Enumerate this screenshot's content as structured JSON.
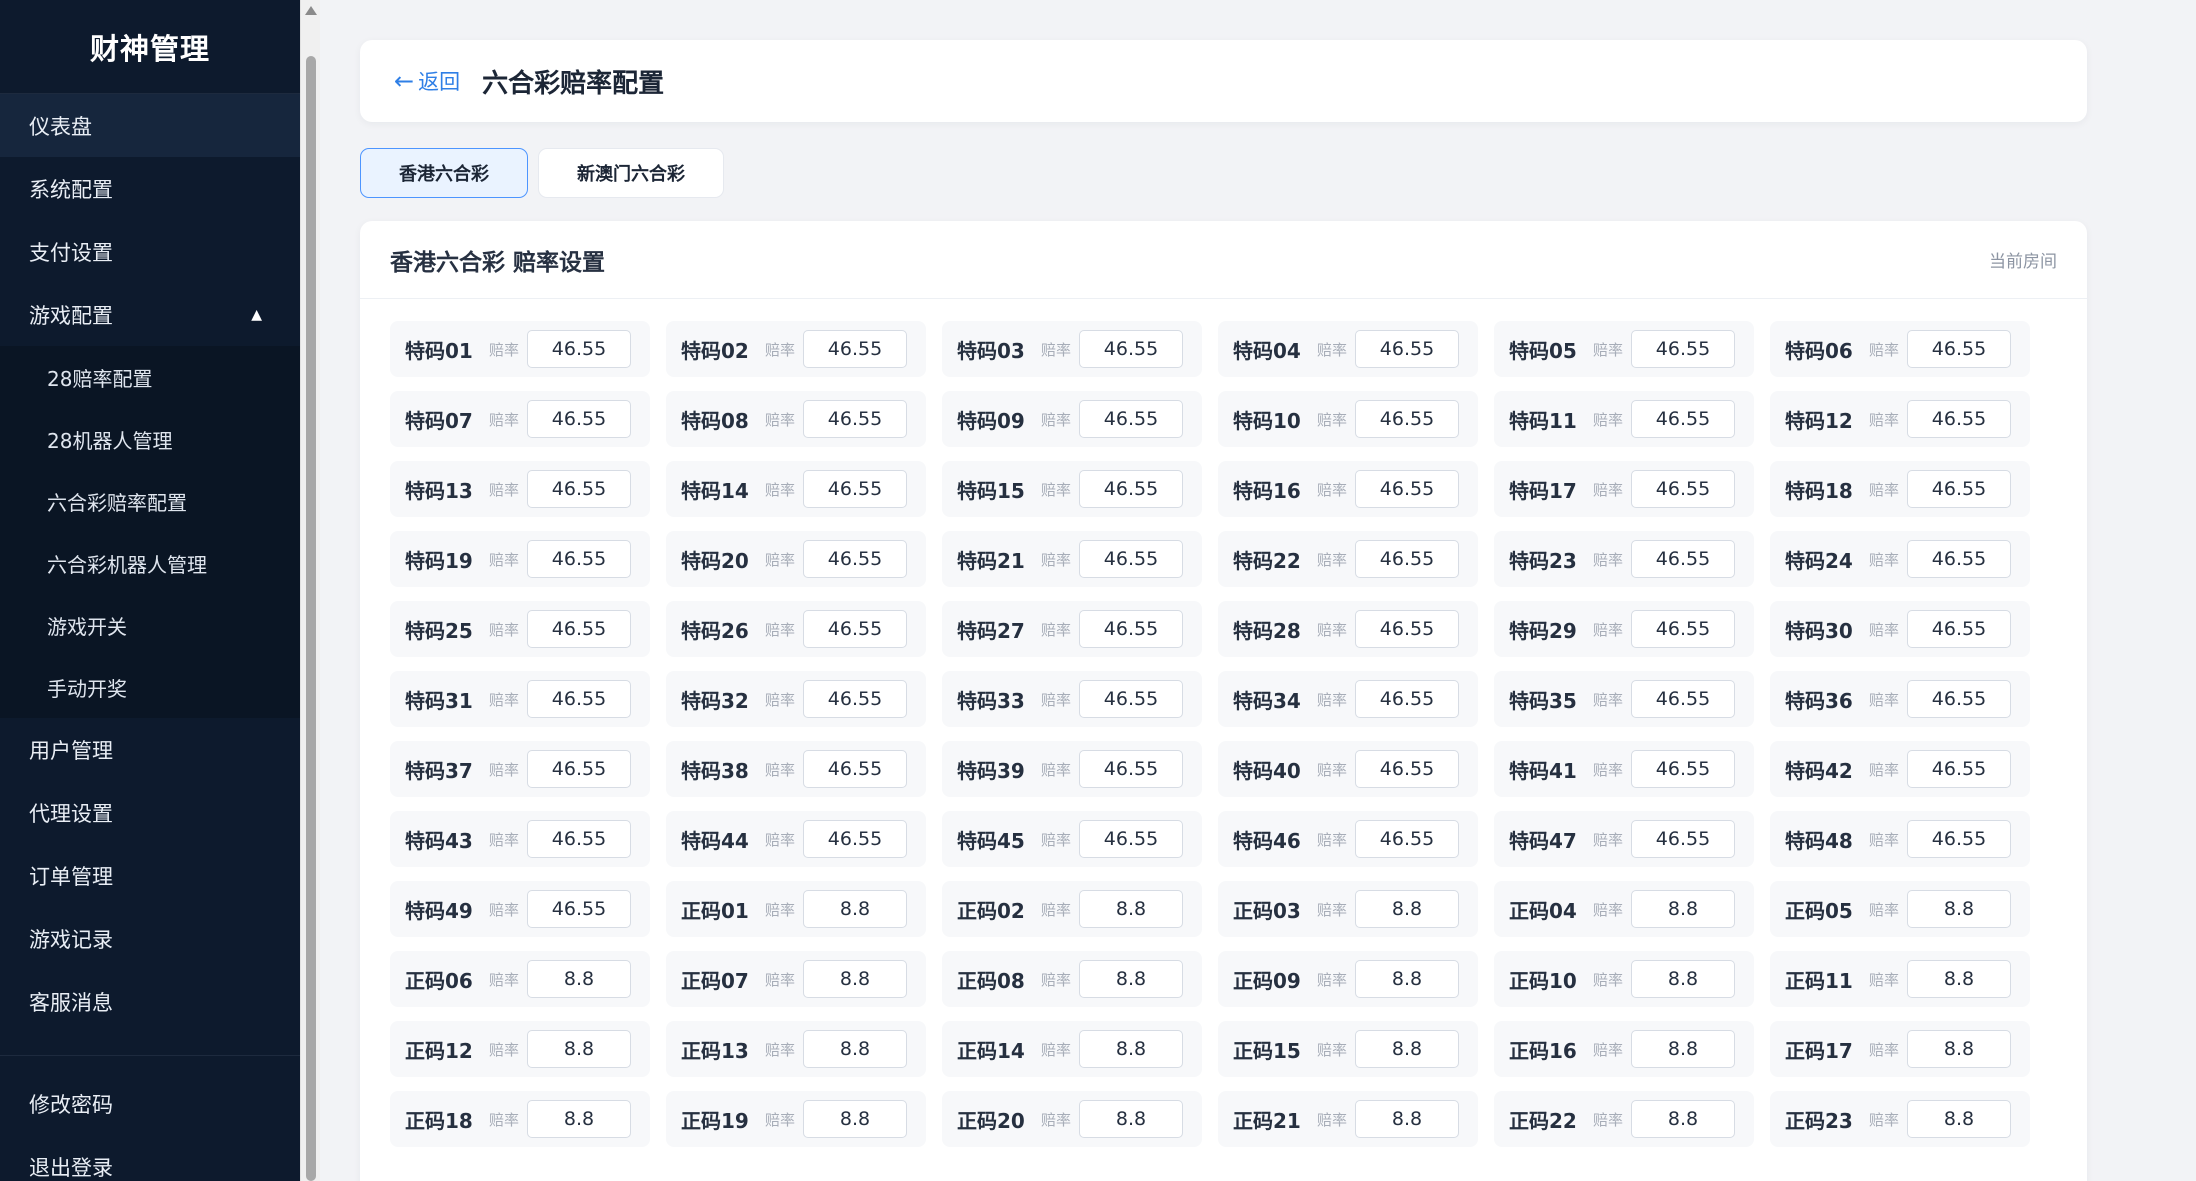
{
  "sidebar": {
    "brand": "财神管理",
    "items": [
      {
        "label": "仪表盘"
      },
      {
        "label": "系统配置"
      },
      {
        "label": "支付设置"
      },
      {
        "label": "游戏配置",
        "caret": "▲"
      },
      {
        "label": "用户管理"
      },
      {
        "label": "代理设置"
      },
      {
        "label": "订单管理"
      },
      {
        "label": "游戏记录"
      },
      {
        "label": "客服消息"
      }
    ],
    "sub_items": [
      {
        "label": "28赔率配置"
      },
      {
        "label": "28机器人管理"
      },
      {
        "label": "六合彩赔率配置"
      },
      {
        "label": "六合彩机器人管理"
      },
      {
        "label": "游戏开关"
      },
      {
        "label": "手动开奖"
      }
    ],
    "bottom_items": [
      {
        "label": "修改密码"
      },
      {
        "label": "退出登录"
      }
    ]
  },
  "header": {
    "back_label": "返回",
    "back_arrow": "←",
    "title": "六合彩赔率配置"
  },
  "tabs": [
    {
      "label": "香港六合彩",
      "active": true
    },
    {
      "label": "新澳门六合彩",
      "active": false
    }
  ],
  "odds_panel": {
    "title": "香港六合彩 赔率设置",
    "room_label": "当前房间",
    "odds_label": "赔率",
    "cells": [
      {
        "code": "特码01",
        "value": "46.55"
      },
      {
        "code": "特码02",
        "value": "46.55"
      },
      {
        "code": "特码03",
        "value": "46.55"
      },
      {
        "code": "特码04",
        "value": "46.55"
      },
      {
        "code": "特码05",
        "value": "46.55"
      },
      {
        "code": "特码06",
        "value": "46.55"
      },
      {
        "code": "特码07",
        "value": "46.55"
      },
      {
        "code": "特码08",
        "value": "46.55"
      },
      {
        "code": "特码09",
        "value": "46.55"
      },
      {
        "code": "特码10",
        "value": "46.55"
      },
      {
        "code": "特码11",
        "value": "46.55"
      },
      {
        "code": "特码12",
        "value": "46.55"
      },
      {
        "code": "特码13",
        "value": "46.55"
      },
      {
        "code": "特码14",
        "value": "46.55"
      },
      {
        "code": "特码15",
        "value": "46.55"
      },
      {
        "code": "特码16",
        "value": "46.55"
      },
      {
        "code": "特码17",
        "value": "46.55"
      },
      {
        "code": "特码18",
        "value": "46.55"
      },
      {
        "code": "特码19",
        "value": "46.55"
      },
      {
        "code": "特码20",
        "value": "46.55"
      },
      {
        "code": "特码21",
        "value": "46.55"
      },
      {
        "code": "特码22",
        "value": "46.55"
      },
      {
        "code": "特码23",
        "value": "46.55"
      },
      {
        "code": "特码24",
        "value": "46.55"
      },
      {
        "code": "特码25",
        "value": "46.55"
      },
      {
        "code": "特码26",
        "value": "46.55"
      },
      {
        "code": "特码27",
        "value": "46.55"
      },
      {
        "code": "特码28",
        "value": "46.55"
      },
      {
        "code": "特码29",
        "value": "46.55"
      },
      {
        "code": "特码30",
        "value": "46.55"
      },
      {
        "code": "特码31",
        "value": "46.55"
      },
      {
        "code": "特码32",
        "value": "46.55"
      },
      {
        "code": "特码33",
        "value": "46.55"
      },
      {
        "code": "特码34",
        "value": "46.55"
      },
      {
        "code": "特码35",
        "value": "46.55"
      },
      {
        "code": "特码36",
        "value": "46.55"
      },
      {
        "code": "特码37",
        "value": "46.55"
      },
      {
        "code": "特码38",
        "value": "46.55"
      },
      {
        "code": "特码39",
        "value": "46.55"
      },
      {
        "code": "特码40",
        "value": "46.55"
      },
      {
        "code": "特码41",
        "value": "46.55"
      },
      {
        "code": "特码42",
        "value": "46.55"
      },
      {
        "code": "特码43",
        "value": "46.55"
      },
      {
        "code": "特码44",
        "value": "46.55"
      },
      {
        "code": "特码45",
        "value": "46.55"
      },
      {
        "code": "特码46",
        "value": "46.55"
      },
      {
        "code": "特码47",
        "value": "46.55"
      },
      {
        "code": "特码48",
        "value": "46.55"
      },
      {
        "code": "特码49",
        "value": "46.55"
      },
      {
        "code": "正码01",
        "value": "8.8"
      },
      {
        "code": "正码02",
        "value": "8.8"
      },
      {
        "code": "正码03",
        "value": "8.8"
      },
      {
        "code": "正码04",
        "value": "8.8"
      },
      {
        "code": "正码05",
        "value": "8.8"
      },
      {
        "code": "正码06",
        "value": "8.8"
      },
      {
        "code": "正码07",
        "value": "8.8"
      },
      {
        "code": "正码08",
        "value": "8.8"
      },
      {
        "code": "正码09",
        "value": "8.8"
      },
      {
        "code": "正码10",
        "value": "8.8"
      },
      {
        "code": "正码11",
        "value": "8.8"
      },
      {
        "code": "正码12",
        "value": "8.8"
      },
      {
        "code": "正码13",
        "value": "8.8"
      },
      {
        "code": "正码14",
        "value": "8.8"
      },
      {
        "code": "正码15",
        "value": "8.8"
      },
      {
        "code": "正码16",
        "value": "8.8"
      },
      {
        "code": "正码17",
        "value": "8.8"
      },
      {
        "code": "正码18",
        "value": "8.8"
      },
      {
        "code": "正码19",
        "value": "8.8"
      },
      {
        "code": "正码20",
        "value": "8.8"
      },
      {
        "code": "正码21",
        "value": "8.8"
      },
      {
        "code": "正码22",
        "value": "8.8"
      },
      {
        "code": "正码23",
        "value": "8.8"
      }
    ]
  },
  "colors": {
    "sidebar_bg": "#0d1a2d",
    "accent": "#2f7fe6",
    "active_tab_bg": "#eaf3ff",
    "page_bg": "#f2f3f6"
  }
}
